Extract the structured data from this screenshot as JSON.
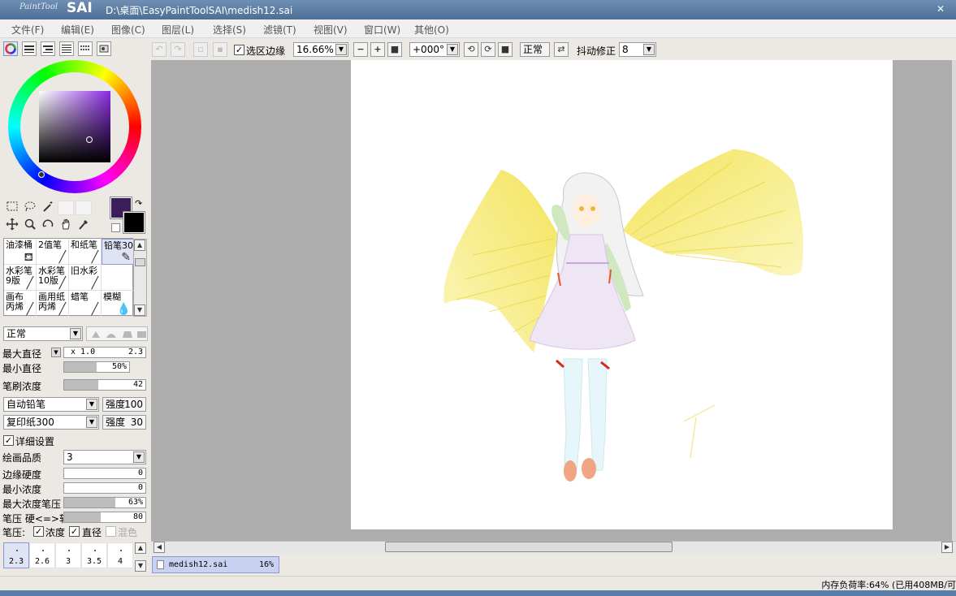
{
  "title": {
    "logo_small": "PaintTool",
    "logo_big": "SAI",
    "path": "D:\\桌面\\EasyPaintToolSAI\\medish12.sai",
    "close": "✕"
  },
  "menu": [
    "文件(F)",
    "编辑(E)",
    "图像(C)",
    "图层(L)",
    "选择(S)",
    "滤镜(T)",
    "视图(V)",
    "窗口(W)",
    "其他(O)"
  ],
  "toolbar": {
    "selection_edge_label": "选区边缘",
    "selection_edge_checked": true,
    "zoom": "16.66%",
    "rotation": "+000°",
    "mode_label": "正常",
    "stabilizer_label": "抖动修正",
    "stabilizer_value": "8"
  },
  "brushes": [
    {
      "label": "油漆桶",
      "icon": "bucket-icon"
    },
    {
      "label": "2值笔",
      "icon": "pen-icon"
    },
    {
      "label": "和纸笔",
      "icon": "pen-icon"
    },
    {
      "label": "铅笔30",
      "icon": "pencil-icon",
      "selected": true
    },
    {
      "label": "水彩笔\n9版",
      "icon": "brush-icon"
    },
    {
      "label": "水彩笔\n10版",
      "icon": "brush-icon"
    },
    {
      "label": "旧水彩",
      "icon": "brush-icon"
    },
    {
      "label": "",
      "icon": ""
    },
    {
      "label": "画布\n丙烯",
      "icon": "brush-icon"
    },
    {
      "label": "画用纸\n丙烯",
      "icon": "brush-icon"
    },
    {
      "label": "蜡笔",
      "icon": "crayon-icon"
    },
    {
      "label": "模糊",
      "icon": "blur-icon"
    }
  ],
  "brush_settings": {
    "blend_mode": "正常",
    "max_size_label": "最大直径",
    "max_size_multiplier": "x 1.0",
    "max_size_value": "2.3",
    "min_size_label": "最小直径",
    "min_size_value": "50%",
    "min_size_fraction": 0.5,
    "density_label": "笔刷浓度",
    "density_value": "42",
    "density_fraction": 0.42,
    "shape_label": "自动铅笔",
    "shape_strength_label": "强度",
    "shape_strength_value": "100",
    "texture_label": "复印纸300",
    "texture_strength_label": "强度",
    "texture_strength_value": "30",
    "detail_label": "详细设置",
    "quality_label": "绘画品质",
    "quality_value": "3",
    "edge_hardness_label": "边缘硬度",
    "edge_hardness_value": "0",
    "min_density_label": "最小浓度",
    "min_density_value": "0",
    "max_density_pressure_label": "最大浓度笔压",
    "max_density_pressure_value": "63%",
    "max_density_pressure_fraction": 0.63,
    "pressure_hardness_label": "笔压 硬<=>软",
    "pressure_hardness_value": "80",
    "pressure_hardness_fraction": 0.45,
    "pressure_label": "笔压:",
    "pressure_density_label": "浓度",
    "pressure_size_label": "直径",
    "pressure_blend_label": "混色"
  },
  "size_presets": [
    "2.3",
    "2.6",
    "3",
    "3.5",
    "4"
  ],
  "file_tab": {
    "name": "medish12.sai",
    "zoom": "16%"
  },
  "status": "内存负荷率:64% (已用408MB/可",
  "colors": {
    "primary": "#3a1d59",
    "secondary": "#000000",
    "accent_select": "#dfe3f3"
  }
}
